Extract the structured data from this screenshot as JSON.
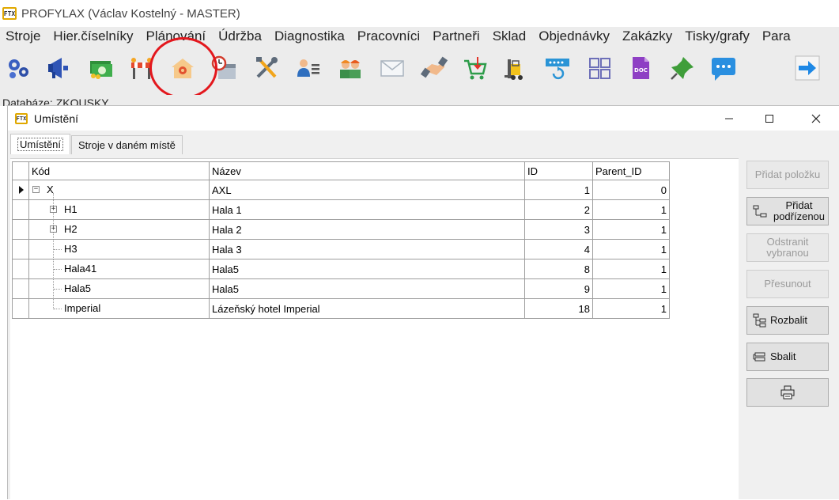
{
  "app": {
    "logo_text": "FTX",
    "title": "PROFYLAX (Václav Kostelný - MASTER)"
  },
  "menu": [
    "Stroje",
    "Hier.číselníky",
    "Plánování",
    "Údržba",
    "Diagnostika",
    "Pracovníci",
    "Partneři",
    "Sklad",
    "Objednávky",
    "Zakázky",
    "Tisky/grafy",
    "Para"
  ],
  "toolbar_icons": [
    "gears-icon",
    "megaphone-icon",
    "money-icon",
    "barrier-icon",
    "location-house-icon",
    "clock-calendar-icon",
    "tools-icon",
    "person-list-icon",
    "workers-icon",
    "envelope-icon",
    "handshake-icon",
    "cart-icon",
    "forklift-icon",
    "refresh-board-icon",
    "grid-icon",
    "doc-icon",
    "pin-icon",
    "chat-icon",
    "exit-arrow-icon"
  ],
  "status": {
    "database": "Databáze: ZKOUSKY"
  },
  "dialog": {
    "logo_text": "FTX",
    "title": "Umístění",
    "tabs": [
      "Umístění",
      "Stroje v daném místě"
    ],
    "columns": [
      "Kód",
      "Název",
      "ID",
      "Parent_ID"
    ],
    "rows": [
      {
        "kod": "X",
        "nazev": "AXL",
        "id": "1",
        "parent_id": "0"
      },
      {
        "kod": "H1",
        "nazev": "Hala 1",
        "id": "2",
        "parent_id": "1"
      },
      {
        "kod": "H2",
        "nazev": "Hala 2",
        "id": "3",
        "parent_id": "1"
      },
      {
        "kod": "H3",
        "nazev": "Hala 3",
        "id": "4",
        "parent_id": "1"
      },
      {
        "kod": "Hala41",
        "nazev": "Hala5",
        "id": "8",
        "parent_id": "1"
      },
      {
        "kod": "Hala5",
        "nazev": "Hala5",
        "id": "9",
        "parent_id": "1"
      },
      {
        "kod": "Imperial",
        "nazev": "Lázeňský hotel Imperial",
        "id": "18",
        "parent_id": "1"
      }
    ],
    "buttons": {
      "add_item": "Přidat položku",
      "add_child": "Přidat podřízenou",
      "remove_selected": "Odstranit vybranou",
      "move": "Přesunout",
      "expand": "Rozbalit",
      "collapse": "Sbalit"
    }
  },
  "colors": {
    "highlight": "#e3171d",
    "accent_blue": "#1e88e5"
  }
}
